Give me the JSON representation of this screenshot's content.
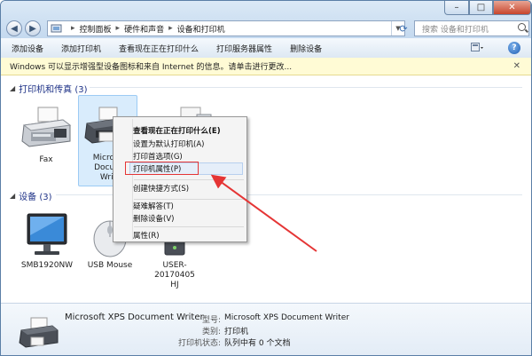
{
  "address": {
    "segments": [
      "控制面板",
      "硬件和声音",
      "设备和打印机"
    ]
  },
  "search": {
    "placeholder": "搜索 设备和打印机"
  },
  "window_controls": {
    "minimize": "–",
    "maximize": "□",
    "close": "✕"
  },
  "toolbar": {
    "items": [
      "添加设备",
      "添加打印机",
      "查看现在正在打印什么",
      "打印服务器属性",
      "删除设备"
    ],
    "help": "?"
  },
  "infobar": {
    "text": "Windows 可以显示增强型设备图标和来自 Internet 的信息。请单击进行更改...",
    "close": "✕"
  },
  "groups": {
    "printers": {
      "label": "打印机和传真 (3)"
    },
    "devices": {
      "label": "设备 (3)"
    }
  },
  "printers": [
    {
      "label": "Fax"
    },
    {
      "label_lines": [
        "Microso",
        "Docum",
        "Writ"
      ]
    }
  ],
  "devices": [
    {
      "label": "SMB1920NW"
    },
    {
      "label": "USB Mouse"
    },
    {
      "label_lines": [
        "USER-20170405",
        "HJ"
      ]
    }
  ],
  "context_menu": {
    "items": [
      {
        "label": "查看现在正在打印什么(E)",
        "bold": true
      },
      {
        "label": "设置为默认打印机(A)"
      },
      {
        "label": "打印首选项(G)"
      },
      {
        "label": "打印机属性(P)",
        "highlighted": true
      },
      {
        "label": "创建快捷方式(S)"
      },
      {
        "label": "疑难解答(T)"
      },
      {
        "label": "删除设备(V)"
      },
      {
        "label": "属性(R)"
      }
    ]
  },
  "details": {
    "name": "Microsoft XPS Document Writer",
    "model_label": "型号:",
    "model_value": "Microsoft XPS Document Writer",
    "category_label": "类别:",
    "category_value": "打印机",
    "status_label": "打印机状态:",
    "status_value": "队列中有 0 个文档"
  },
  "colors": {
    "annotation_red": "#e53535",
    "group_text": "#1e3287"
  }
}
